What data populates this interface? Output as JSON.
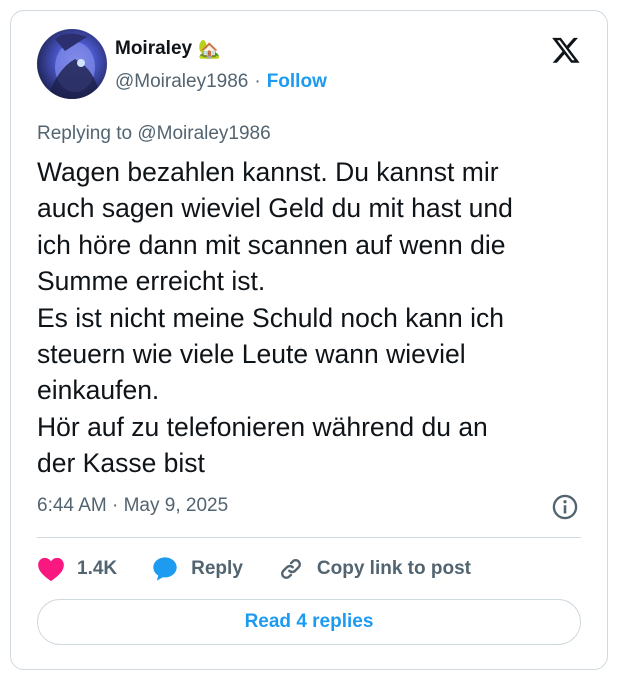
{
  "author": {
    "name": "Moiraley",
    "name_emoji": "🏡",
    "handle": "@Moiraley1986",
    "separator": "·",
    "follow_label": "Follow"
  },
  "replying_to": "Replying to @Moiraley1986",
  "tweet_text": "Wagen bezahlen kannst. Du kannst mir\nauch sagen wieviel Geld du mit hast und\nich höre dann mit scannen auf wenn die\nSumme erreicht ist.\nEs ist nicht meine Schuld noch kann ich\nsteuern wie viele Leute wann wieviel\neinkaufen.\nHör auf zu telefonieren während du an\nder Kasse bist",
  "timestamp": "6:44 AM · May 9, 2025",
  "actions": {
    "like_count": "1.4K",
    "reply_label": "Reply",
    "copy_label": "Copy link to post"
  },
  "read_replies_label": "Read 4 replies",
  "icons": {
    "logo": "x-logo-icon",
    "like": "heart-icon",
    "reply": "speech-bubble-icon",
    "copy": "link-icon",
    "info": "info-icon"
  },
  "colors": {
    "accent": "#1d9bf0",
    "like": "#f91880",
    "muted": "#536471",
    "border": "#cfd9de"
  }
}
